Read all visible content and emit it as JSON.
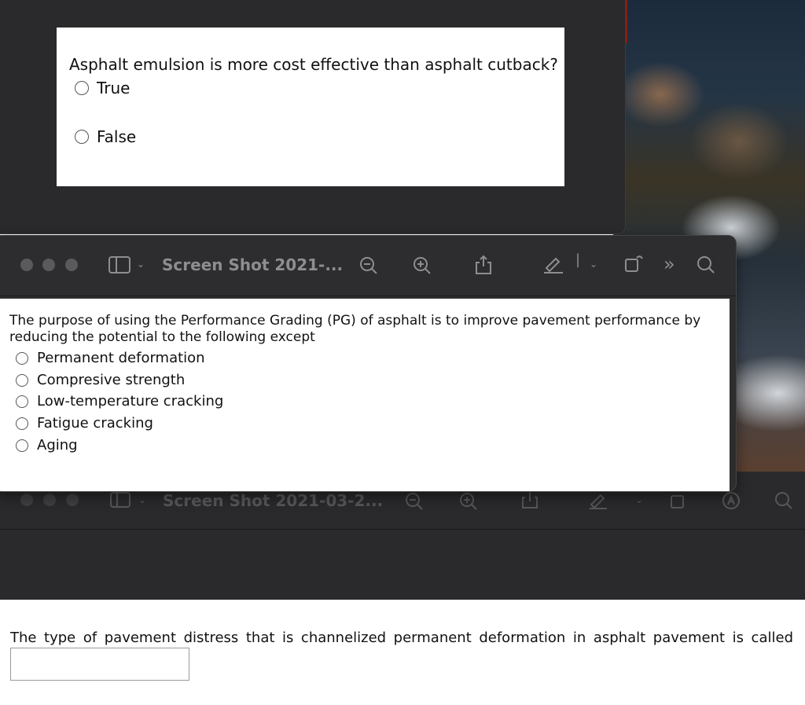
{
  "question1": {
    "prompt": "Asphalt emulsion is more cost effective than asphalt cutback?",
    "options": [
      "True",
      "False"
    ]
  },
  "preview_window": {
    "title": "Screen Shot 2021-..."
  },
  "question2": {
    "prompt": "The purpose of using the Performance Grading (PG) of asphalt is to improve pavement performance by reducing the potential to the following except",
    "options": [
      "Permanent deformation",
      "Compresive strength",
      "Low-temperature cracking",
      "Fatigue cracking",
      "Aging"
    ]
  },
  "background_window": {
    "title": "Screen Shot 2021-03-2..."
  },
  "question3": {
    "prompt": "The type of pavement distress that is channelized permanent deformation in asphalt pavement is called",
    "answer_value": ""
  },
  "colors": {
    "window_bg": "#2d2d2f",
    "toolbar_icon": "#8e8e90",
    "window_dot": "#5a5a5c"
  },
  "icons": {
    "toolbar": [
      "sidebar-icon",
      "chevron-down-icon",
      "zoom-out-icon",
      "zoom-in-icon",
      "share-icon",
      "markup-pen-icon",
      "rotate-icon",
      "more-icon",
      "search-icon"
    ],
    "background_toolbar": [
      "sidebar-icon",
      "chevron-down-icon",
      "zoom-out-icon",
      "zoom-in-icon",
      "share-icon",
      "markup-pen-icon",
      "rotate-icon",
      "markup-circle-icon",
      "search-icon"
    ]
  }
}
